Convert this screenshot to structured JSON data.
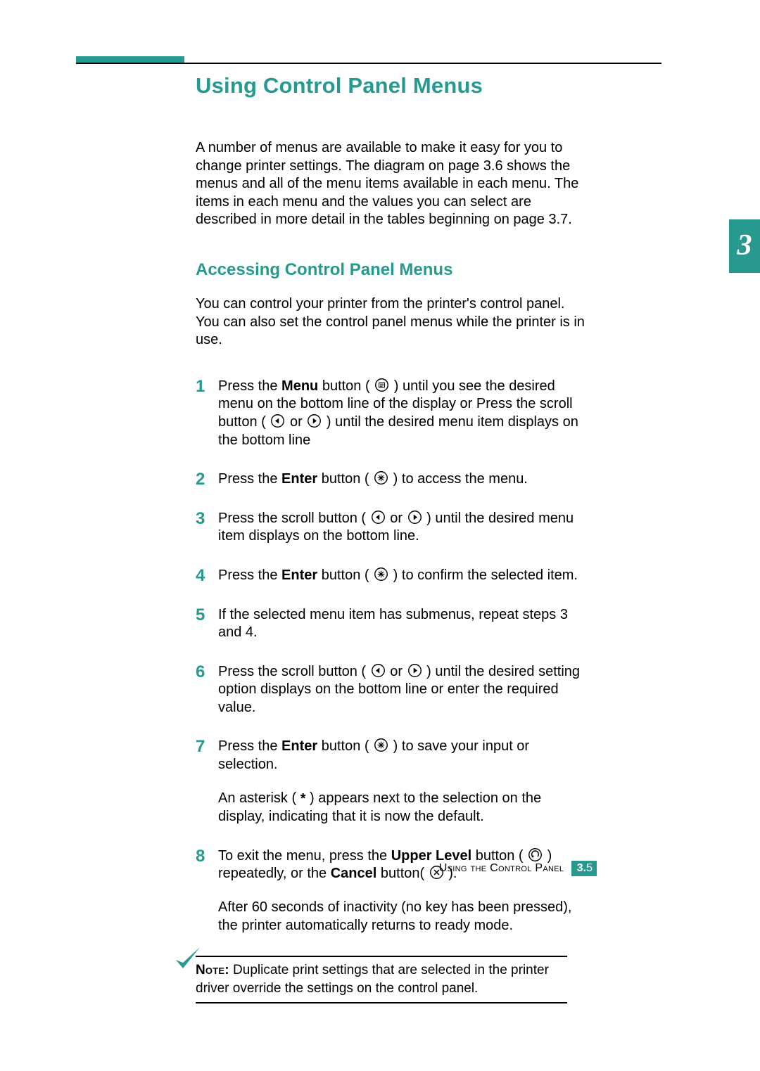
{
  "chapter_tab": "3",
  "title": "Using Control Panel Menus",
  "intro": "A number of menus are available to make it easy for you to change printer settings. The diagram on page 3.6 shows the menus and all of the menu items available in each menu. The items in each menu and the values you can select are described in more detail in the tables beginning on page 3.7.",
  "subheading": "Accessing Control Panel Menus",
  "lead": "You can control your printer from the printer's control panel. You can also set the control panel menus while the printer is in use.",
  "steps": {
    "s1": {
      "num": "1",
      "a": "Press the ",
      "b1": "Menu",
      "c": " button ( ",
      "d": " ) until you see the desired menu on the bottom line of the display or Press the scroll button ( ",
      "e": " or ",
      "f": " ) until the desired menu item displays on the bottom line"
    },
    "s2": {
      "num": "2",
      "a": "Press the ",
      "b1": "Enter",
      "c": " button ( ",
      "d": " ) to access the menu."
    },
    "s3": {
      "num": "3",
      "a": "Press the scroll button ( ",
      "b": " or ",
      "c": " ) until the desired menu item displays on the bottom line."
    },
    "s4": {
      "num": "4",
      "a": "Press the ",
      "b1": "Enter",
      "c": " button ( ",
      "d": " ) to confirm the selected item."
    },
    "s5": {
      "num": "5",
      "a": "If the selected menu item has submenus, repeat steps 3 and 4."
    },
    "s6": {
      "num": "6",
      "a": "Press the scroll button ( ",
      "b": " or ",
      "c": " ) until the desired setting option displays on the bottom line or enter the required value."
    },
    "s7": {
      "num": "7",
      "a": "Press the ",
      "b1": "Enter",
      "c": " button ( ",
      "d": " ) to save your input or selection.",
      "follow_a": "An asterisk ( ",
      "follow_b": " ) appears next to the selection on the display, indicating that it is now the default."
    },
    "s8": {
      "num": "8",
      "a": "To exit the menu, press the ",
      "b1": "Upper Level",
      "c": " button ( ",
      "d": " ) repeatedly, or the ",
      "b2": "Cancel",
      "e": " button( ",
      "f": " ).",
      "follow": "After 60 seconds of inactivity (no key has been pressed), the printer automatically returns to ready mode."
    }
  },
  "note": {
    "label": "Note:",
    "text": " Duplicate print settings that are selected in the printer driver override the settings on the control panel."
  },
  "footer": {
    "label": "Using the Control Panel",
    "chapter": "3.",
    "page": "5"
  },
  "icons": {
    "menu": "menu-icon",
    "left": "scroll-left-icon",
    "right": "scroll-right-icon",
    "enter": "enter-asterisk-icon",
    "upper": "upper-level-icon",
    "cancel": "cancel-x-icon",
    "asterisk": "*"
  }
}
